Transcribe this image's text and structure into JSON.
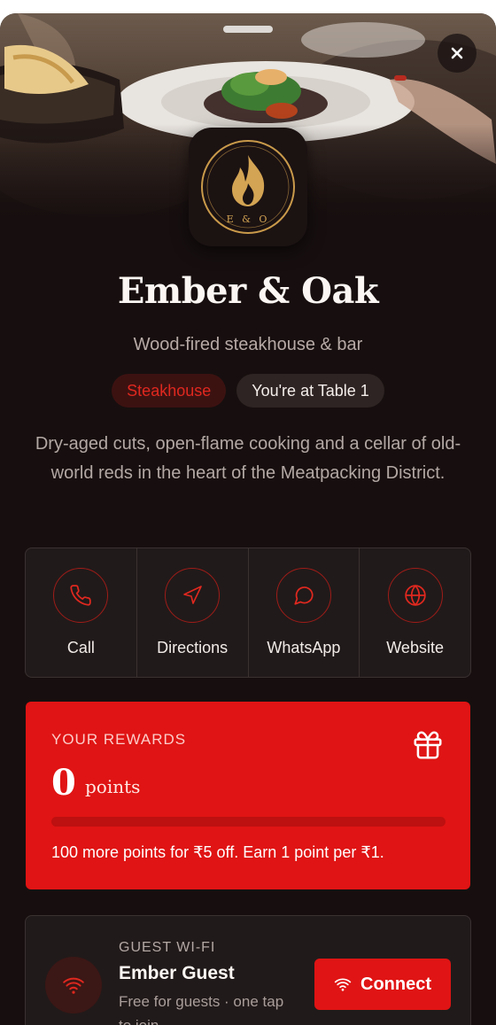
{
  "restaurant": {
    "name": "Ember & Oak",
    "tagline": "Wood-fired steakhouse & bar",
    "category": "Steakhouse",
    "table_status": "You're at Table 1",
    "description": "Dry-aged cuts, open-flame cooking and a cellar of old-world reds in the heart of the Meatpacking District.",
    "logo_monogram": "E & O"
  },
  "actions": [
    {
      "label": "Call",
      "icon": "phone-icon"
    },
    {
      "label": "Directions",
      "icon": "navigation-arrow-icon"
    },
    {
      "label": "WhatsApp",
      "icon": "chat-bubble-icon"
    },
    {
      "label": "Website",
      "icon": "globe-icon"
    }
  ],
  "rewards": {
    "label": "YOUR REWARDS",
    "points": "0",
    "points_unit": "points",
    "progress_fraction": 0,
    "note": "100 more points for ₹5 off. Earn 1 point per ₹1."
  },
  "wifi": {
    "label": "GUEST WI-FI",
    "network_name": "Ember Guest",
    "description": "Free for guests · one tap to join",
    "button_label": "Connect"
  },
  "colors": {
    "accent": "#e01414",
    "background": "#170f0f",
    "card": "#211a1a",
    "gold": "#d3a453"
  }
}
